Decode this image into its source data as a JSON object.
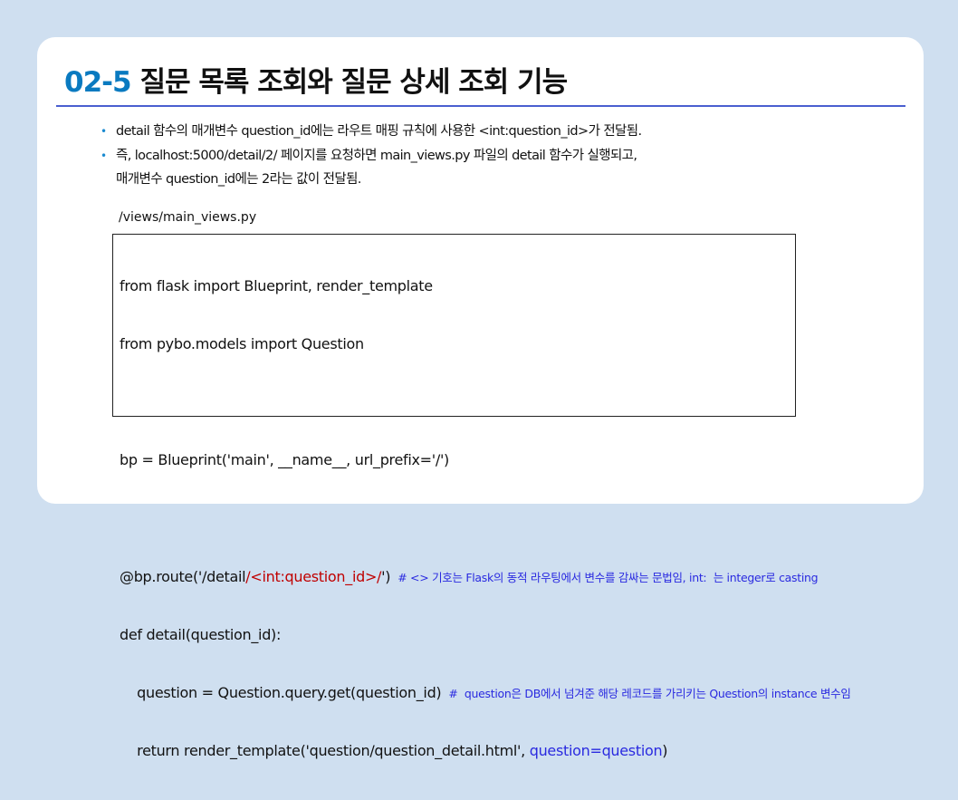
{
  "title": {
    "number": "02-5",
    "text": "질문 목록 조회와 질문 상세 조회 기능"
  },
  "bullets": [
    {
      "text": "detail 함수의 매개변수 question_id에는 라우트 매핑 규칙에 사용한 <int:question_id>가 전달됨."
    },
    {
      "text": "즉, localhost:5000/detail/2/ 페이지를 요청하면 main_views.py 파일의 detail 함수가 실행되고,",
      "cont": "매개변수 question_id에는 2라는 값이 전달됨."
    }
  ],
  "file_path": "/views/main_views.py",
  "code": {
    "l1": "from flask import Blueprint, render_template",
    "l2": "from pybo.models import Question",
    "l3": "bp = Blueprint('main', __name__, url_prefix='/')",
    "l4a": "@bp.route('/detail",
    "l4b": "/<int:question_id>/",
    "l4c": "')",
    "l4cmt": "# <> 기호는 Flask의 동적 라우팅에서 변수를 감싸는 문법임, int:  는 integer로 casting",
    "l5": "def detail(question_id):",
    "l6": "    question = Question.query.get(question_id)",
    "l6cmt": "#  question은 DB에서 넘겨준 해당 레코드를 가리키는 Question의 instance 변수임",
    "l7a": "    return render_template('question/question_detail.html', ",
    "l7b": "question=question",
    "l7c": ")"
  }
}
